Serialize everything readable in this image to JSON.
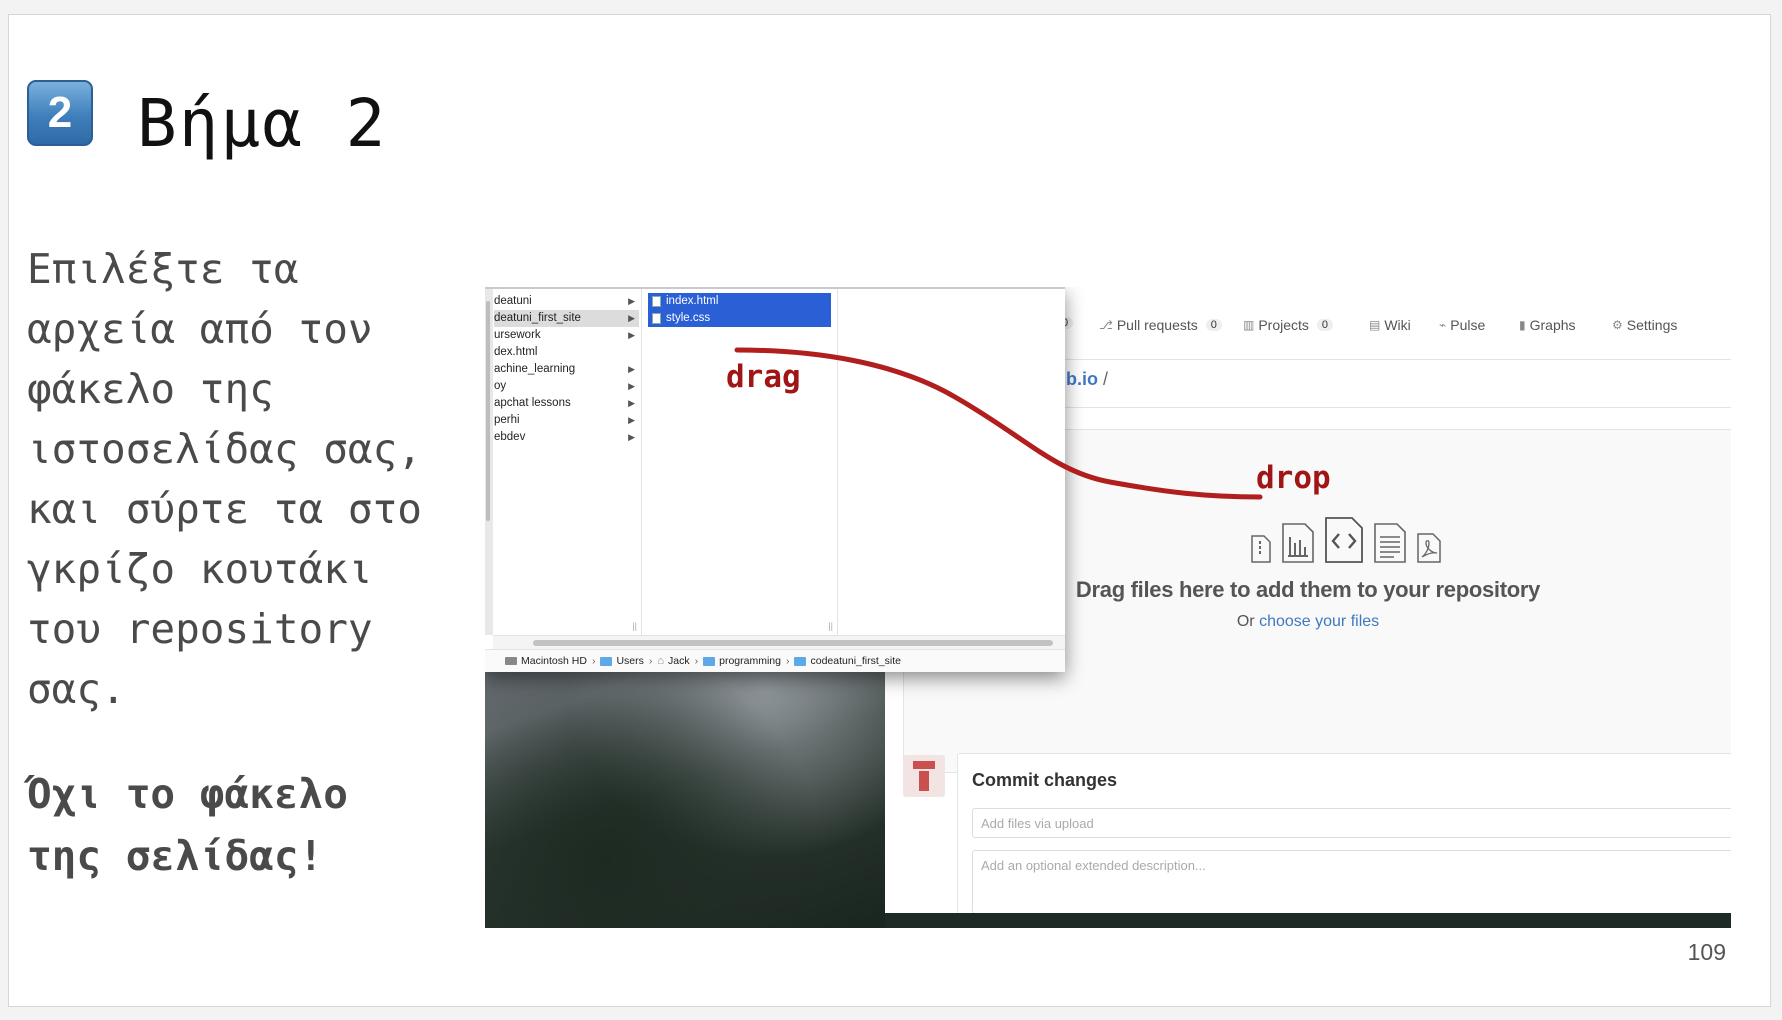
{
  "slide": {
    "badge": "2",
    "title": "Βήμα 2",
    "body_lines": [
      "Επιλέξτε τα",
      "αρχεία από τον",
      "φάκελο της",
      "ιστοσελίδας σας,",
      "και σύρτε τα στο",
      "γκρίζο κουτάκι",
      "του repository",
      "σας."
    ],
    "warning_lines": [
      "Όχι το φάκελο",
      "της σελίδας!"
    ],
    "page_number": "109"
  },
  "annotations": {
    "drag": "drag",
    "drop": "drop",
    "curve_color": "#b01e1e"
  },
  "finder": {
    "folders": [
      "deatuni",
      "deatuni_first_site",
      "ursework",
      "dex.html",
      "achine_learning",
      "oy",
      "apchat lessons",
      "perhi",
      "ebdev"
    ],
    "folder_has_arrow": [
      true,
      true,
      true,
      false,
      true,
      true,
      true,
      true,
      true
    ],
    "selected_folder": "deatuni_first_site",
    "selected_files": [
      "index.html",
      "style.css"
    ],
    "path": [
      "Macintosh HD",
      "Users",
      "Jack",
      "programming",
      "codeatuni_first_site"
    ]
  },
  "github": {
    "tabs": [
      {
        "label": "",
        "count": "0"
      },
      {
        "label": "Pull requests",
        "count": "0"
      },
      {
        "label": "Projects",
        "count": "0"
      },
      {
        "label": "Wiki",
        "count": ""
      },
      {
        "label": "Pulse",
        "count": ""
      },
      {
        "label": "Graphs",
        "count": ""
      },
      {
        "label": "Settings",
        "count": ""
      }
    ],
    "path": "ub.io",
    "path_sep": "/",
    "drop_title": "Drag files here to add them to your repository",
    "drop_sub_prefix": "Or",
    "drop_sub_link": "choose your files",
    "commit_title": "Commit changes",
    "commit_placeholder": "Add files via upload",
    "desc_placeholder": "Add an optional extended description..."
  },
  "colors": {
    "accent_blue": "#4078c0",
    "finder_selection": "#2a5fd6",
    "badge_blue": "#3f7fbb"
  }
}
